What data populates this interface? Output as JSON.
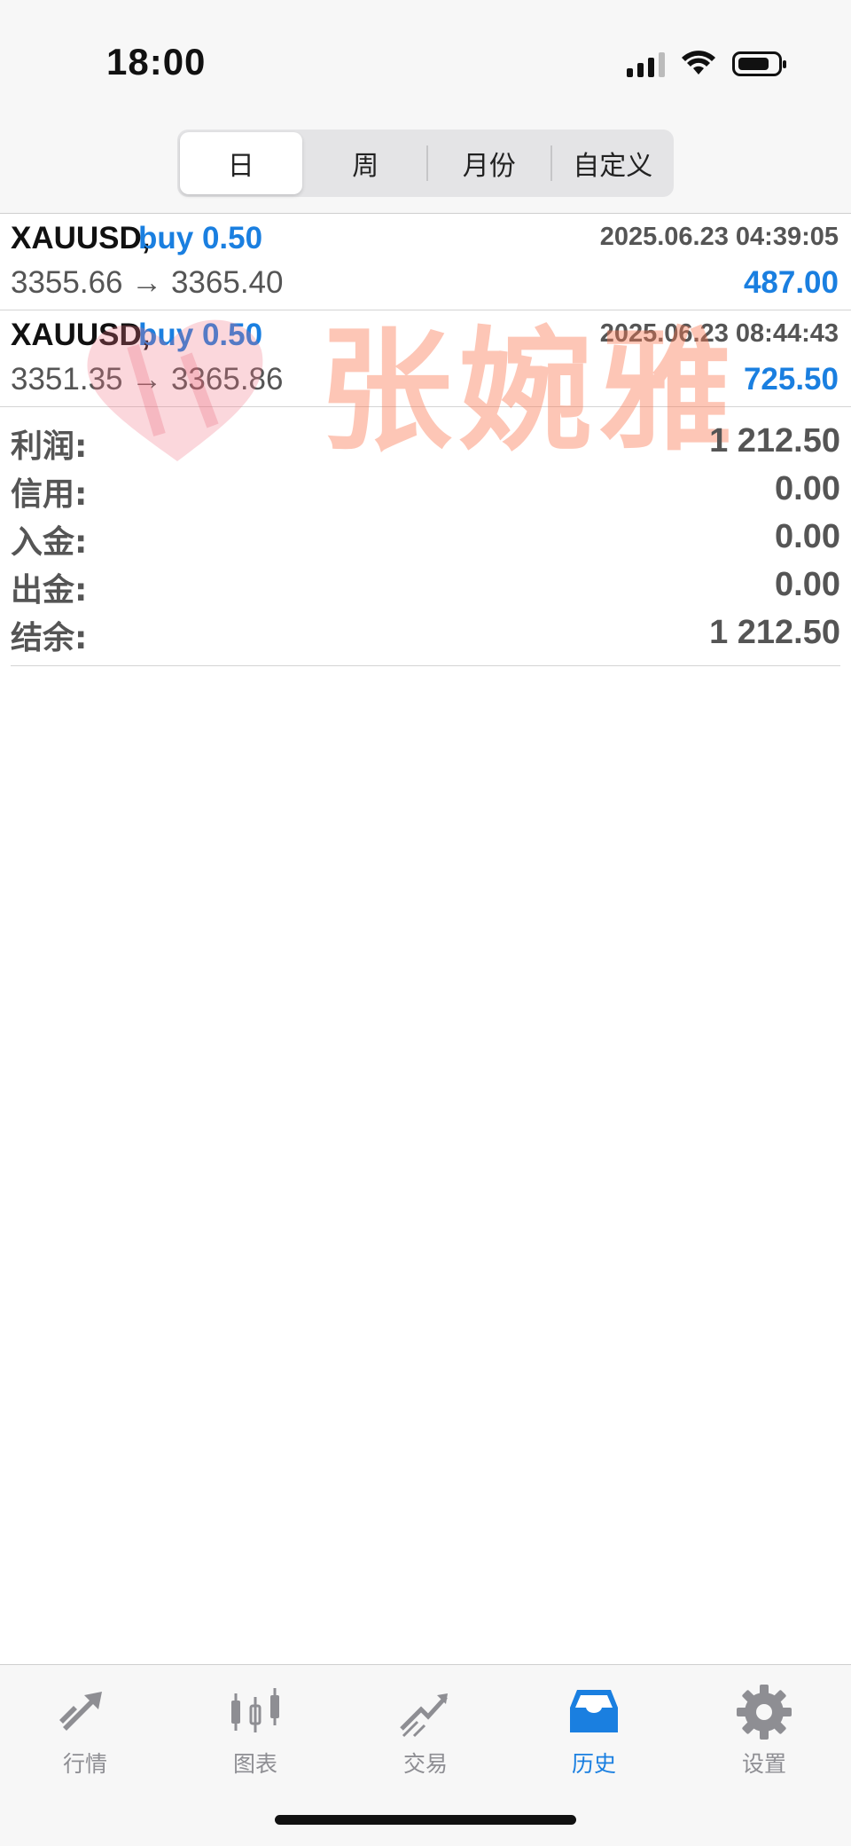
{
  "status_bar": {
    "time": "18:00"
  },
  "segments": [
    {
      "label": "日",
      "active": true
    },
    {
      "label": "周",
      "active": false
    },
    {
      "label": "月份",
      "active": false
    },
    {
      "label": "自定义",
      "active": false
    }
  ],
  "trades": [
    {
      "symbol": "XAUUSD,",
      "type": "buy 0.50",
      "time": "2025.06.23 04:39:05",
      "prices": "3355.66 → 3365.40",
      "profit": "487.00"
    },
    {
      "symbol": "XAUUSD,",
      "type": "buy 0.50",
      "time": "2025.06.23 08:44:43",
      "prices": "3351.35 → 3365.86",
      "profit": "725.50"
    }
  ],
  "summary": [
    {
      "label": "利润:",
      "value": "1 212.50"
    },
    {
      "label": "信用:",
      "value": "0.00"
    },
    {
      "label": "入金:",
      "value": "0.00"
    },
    {
      "label": "出金:",
      "value": "0.00"
    },
    {
      "label": "结余:",
      "value": "1 212.50"
    }
  ],
  "watermark": {
    "text": "张婉雅"
  },
  "tabs": [
    {
      "label": "行情",
      "icon": "quotes-icon",
      "active": false
    },
    {
      "label": "图表",
      "icon": "chart-icon",
      "active": false
    },
    {
      "label": "交易",
      "icon": "trade-icon",
      "active": false
    },
    {
      "label": "历史",
      "icon": "history-icon",
      "active": true
    },
    {
      "label": "设置",
      "icon": "settings-icon",
      "active": false
    }
  ],
  "colors": {
    "accent": "#1a7fe0",
    "inactive": "#8e8e93",
    "text": "#555555"
  }
}
